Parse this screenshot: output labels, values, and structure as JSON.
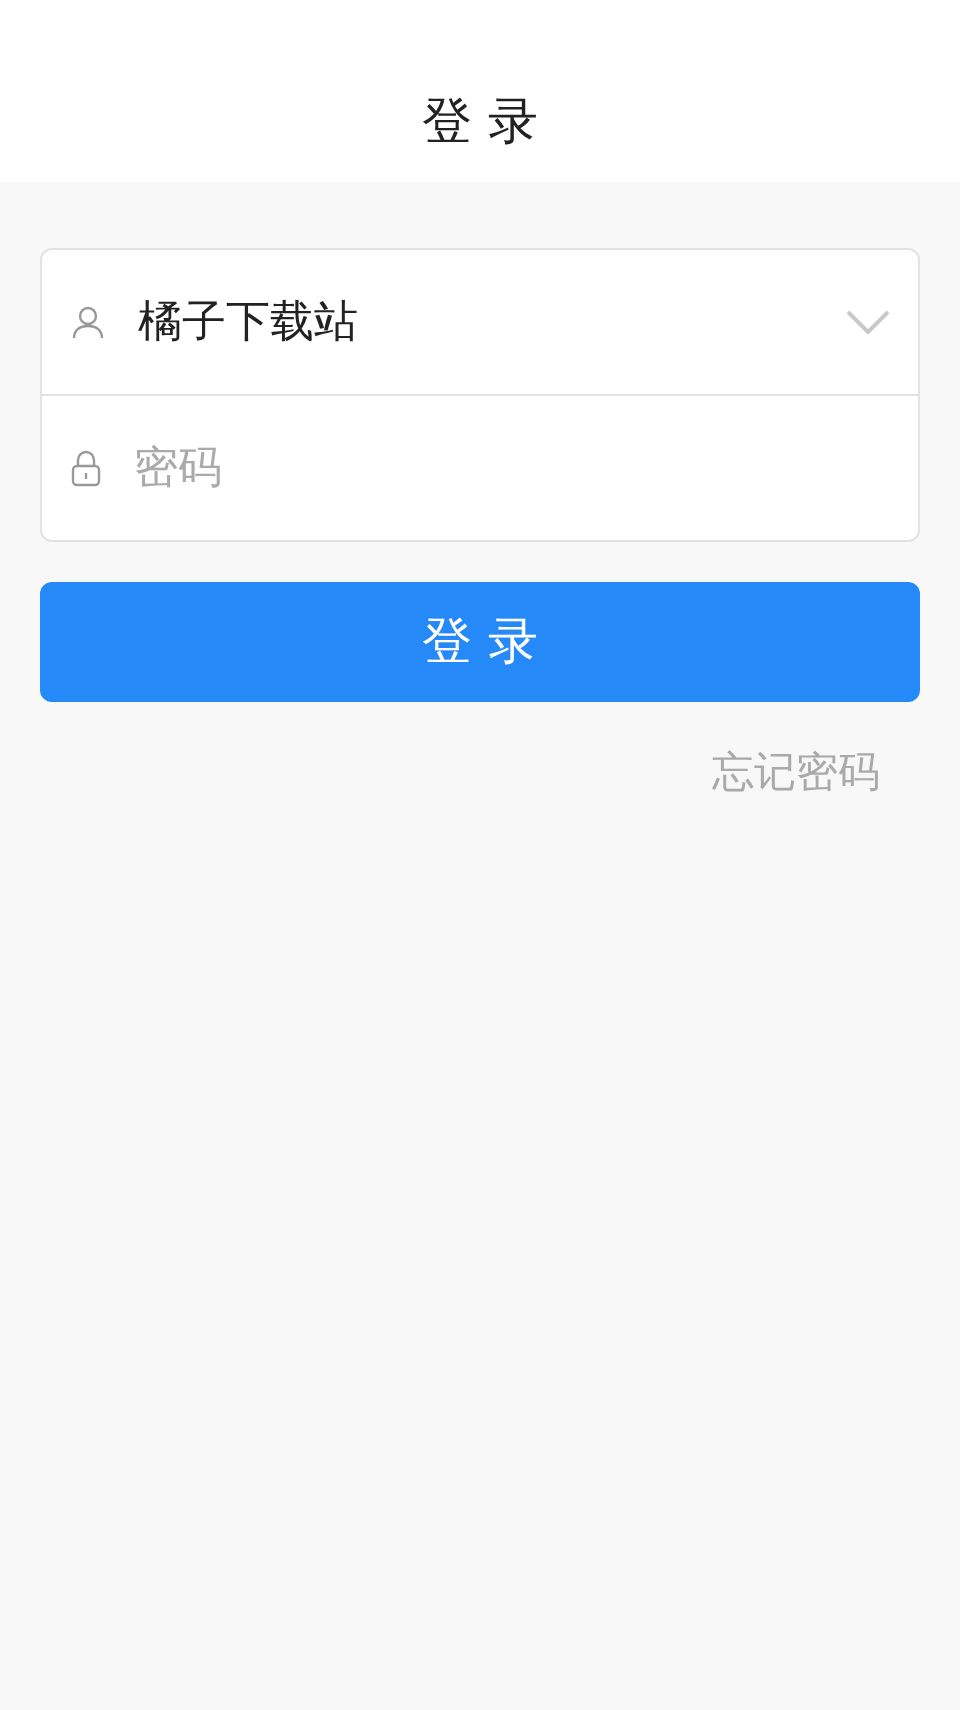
{
  "header": {
    "title": "登 录"
  },
  "form": {
    "username": {
      "value": "橘子下载站"
    },
    "password": {
      "placeholder": "密码"
    }
  },
  "login_button": "登 录",
  "forgot_link": "忘记密码"
}
